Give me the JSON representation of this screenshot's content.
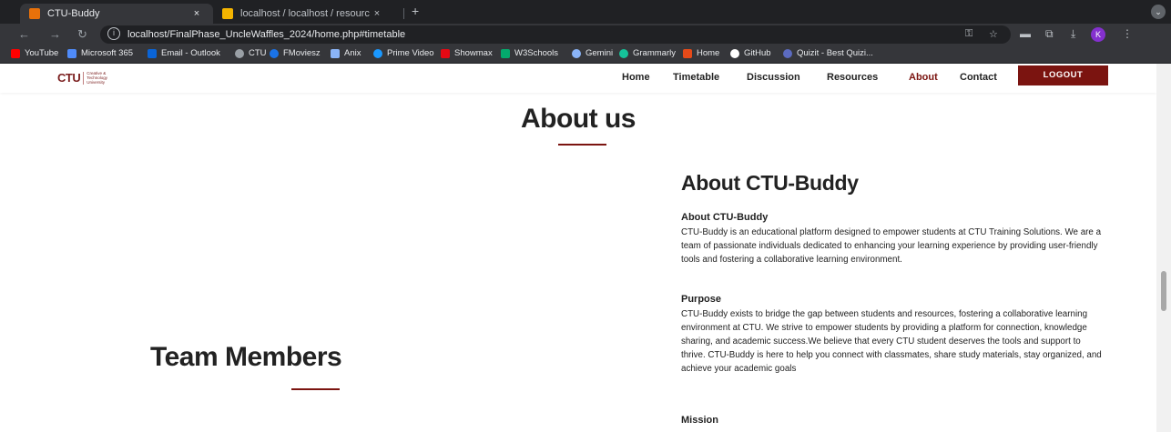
{
  "browser": {
    "tabs": [
      {
        "title": "CTU-Buddy",
        "favicon_color": "#e8710a",
        "close": "×"
      },
      {
        "title": "localhost / localhost / resourc",
        "favicon_color": "#f4b400",
        "close": "×"
      }
    ],
    "new_tab": "+",
    "tab_menu": "⌄",
    "url": "localhost/FinalPhase_UncleWaffles_2024/home.php#timetable",
    "profile_initial": "K",
    "bookmarks": [
      {
        "label": "YouTube",
        "color": "#ff0000"
      },
      {
        "label": "Microsoft 365",
        "color": "#4f8bf9"
      },
      {
        "label": "Email - Outlook",
        "color": "#0a64d6"
      },
      {
        "label": "CTU",
        "color": "#9aa0a6"
      },
      {
        "label": "FMoviesz",
        "color": "#1a73e8"
      },
      {
        "label": "Anix",
        "color": "#8ab4f8"
      },
      {
        "label": "Prime Video",
        "color": "#1a98ff"
      },
      {
        "label": "Showmax",
        "color": "#e50914"
      },
      {
        "label": "W3Schools",
        "color": "#04aa6d"
      },
      {
        "label": "Gemini",
        "color": "#8ab4f8"
      },
      {
        "label": "Grammarly",
        "color": "#15c39a"
      },
      {
        "label": "Home",
        "color": "#e64a19"
      },
      {
        "label": "GitHub",
        "color": "#ffffff"
      },
      {
        "label": "Quizit - Best Quizi...",
        "color": "#5c6bc0"
      }
    ]
  },
  "site": {
    "logo": {
      "mark": "CTU",
      "text_lines": [
        "Creative &",
        "Technology",
        "University"
      ]
    },
    "nav": [
      "Home",
      "Timetable",
      "Discussion",
      "Resources",
      "About",
      "Contact"
    ],
    "active_nav": "About",
    "logout_label": "LOGOUT",
    "accent_color": "#7b1410",
    "about_heading": "About us",
    "team_heading": "Team Members",
    "about_section": {
      "heading": "About CTU-Buddy",
      "blocks": [
        {
          "title": "About CTU-Buddy",
          "text": "CTU-Buddy is an educational platform designed to empower students at CTU Training Solutions. We are a team of passionate individuals dedicated to enhancing your learning experience by providing user-friendly tools and fostering a collaborative learning environment."
        },
        {
          "title": "Purpose",
          "text": "CTU-Buddy exists to bridge the gap between students and resources, fostering a collaborative learning environment at CTU. We strive to empower students by providing a platform for connection, knowledge sharing, and academic success.We believe that every CTU student deserves the tools and support to thrive. CTU-Buddy is here to help you connect with classmates, share study materials, stay organized, and achieve your academic goals"
        },
        {
          "title": "Mission",
          "text": ""
        }
      ]
    }
  }
}
